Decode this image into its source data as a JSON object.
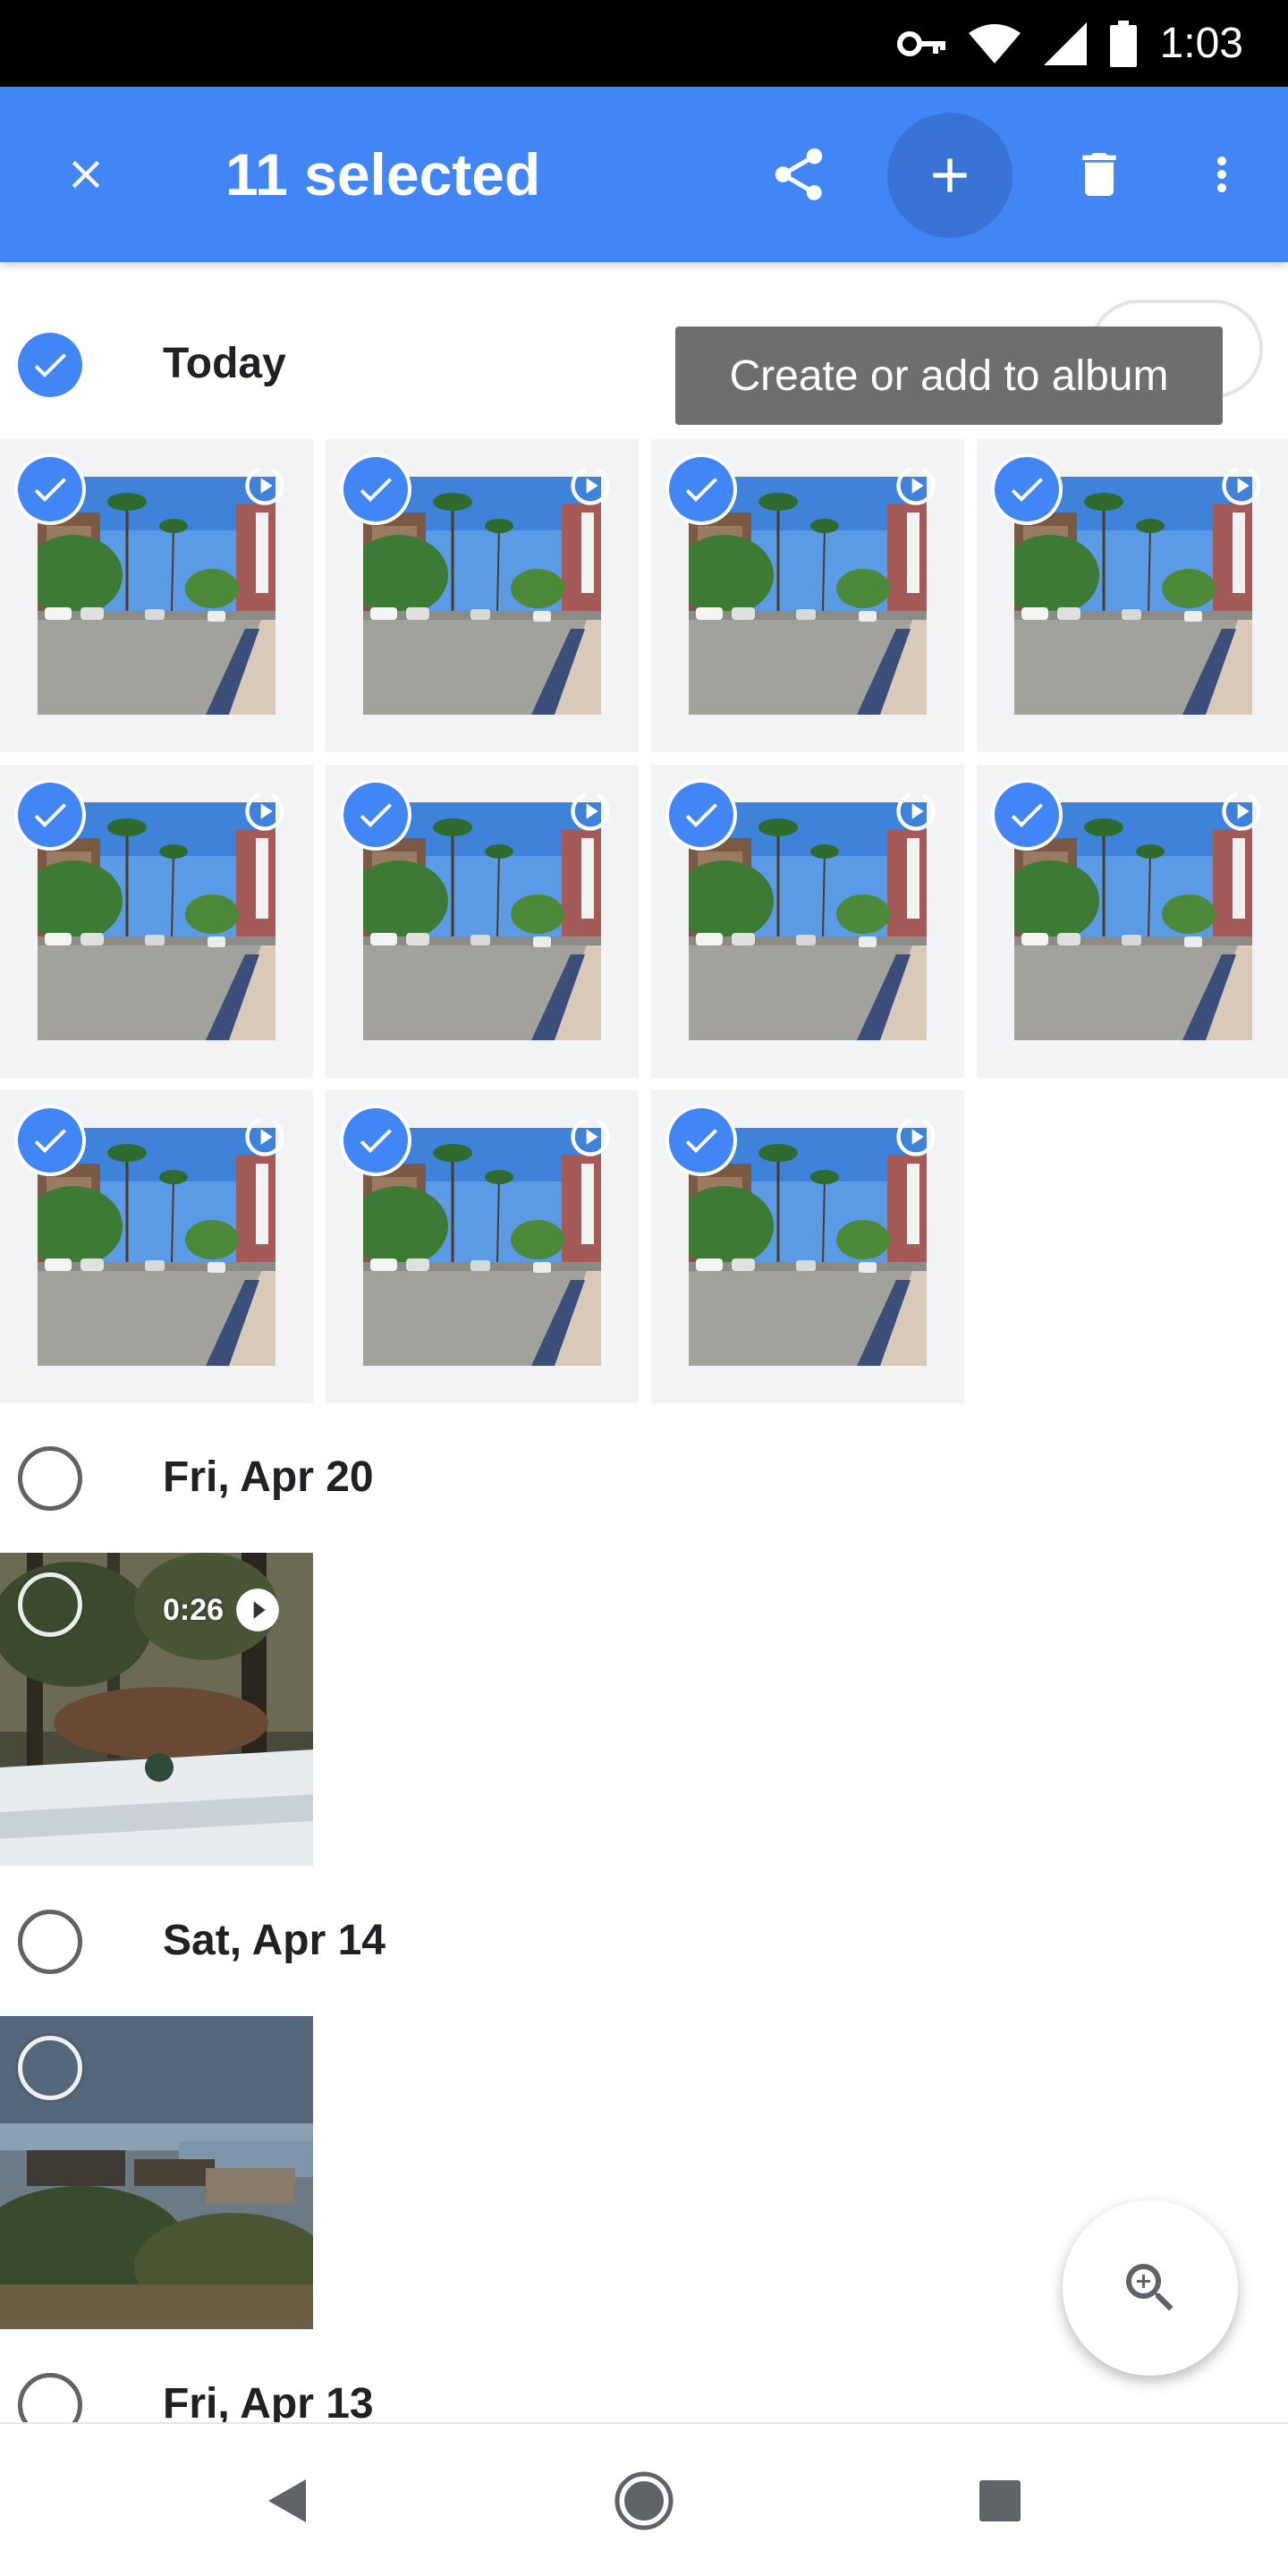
{
  "status_bar": {
    "time": "1:03",
    "icons": [
      "vpn-key-icon",
      "wifi-icon",
      "signal-icon",
      "battery-icon"
    ]
  },
  "app_bar": {
    "title": "11 selected",
    "color": "#4285f4",
    "actions": [
      "close-icon",
      "share-icon",
      "add-icon",
      "delete-icon",
      "more-vert-icon"
    ]
  },
  "tooltip": {
    "text": "Create or add to album"
  },
  "sections": [
    {
      "label": "Today",
      "selected": true,
      "photo_count": 11
    },
    {
      "label": "Fri, Apr 20",
      "selected": false,
      "video_duration": "0:26"
    },
    {
      "label": "Sat, Apr 14",
      "selected": false
    },
    {
      "label": "Fri, Apr 13",
      "selected": false
    }
  ],
  "fab": {
    "icon": "zoom-in-icon"
  },
  "nav_bar": {
    "icons": [
      "back-icon",
      "home-icon",
      "recents-icon"
    ]
  }
}
